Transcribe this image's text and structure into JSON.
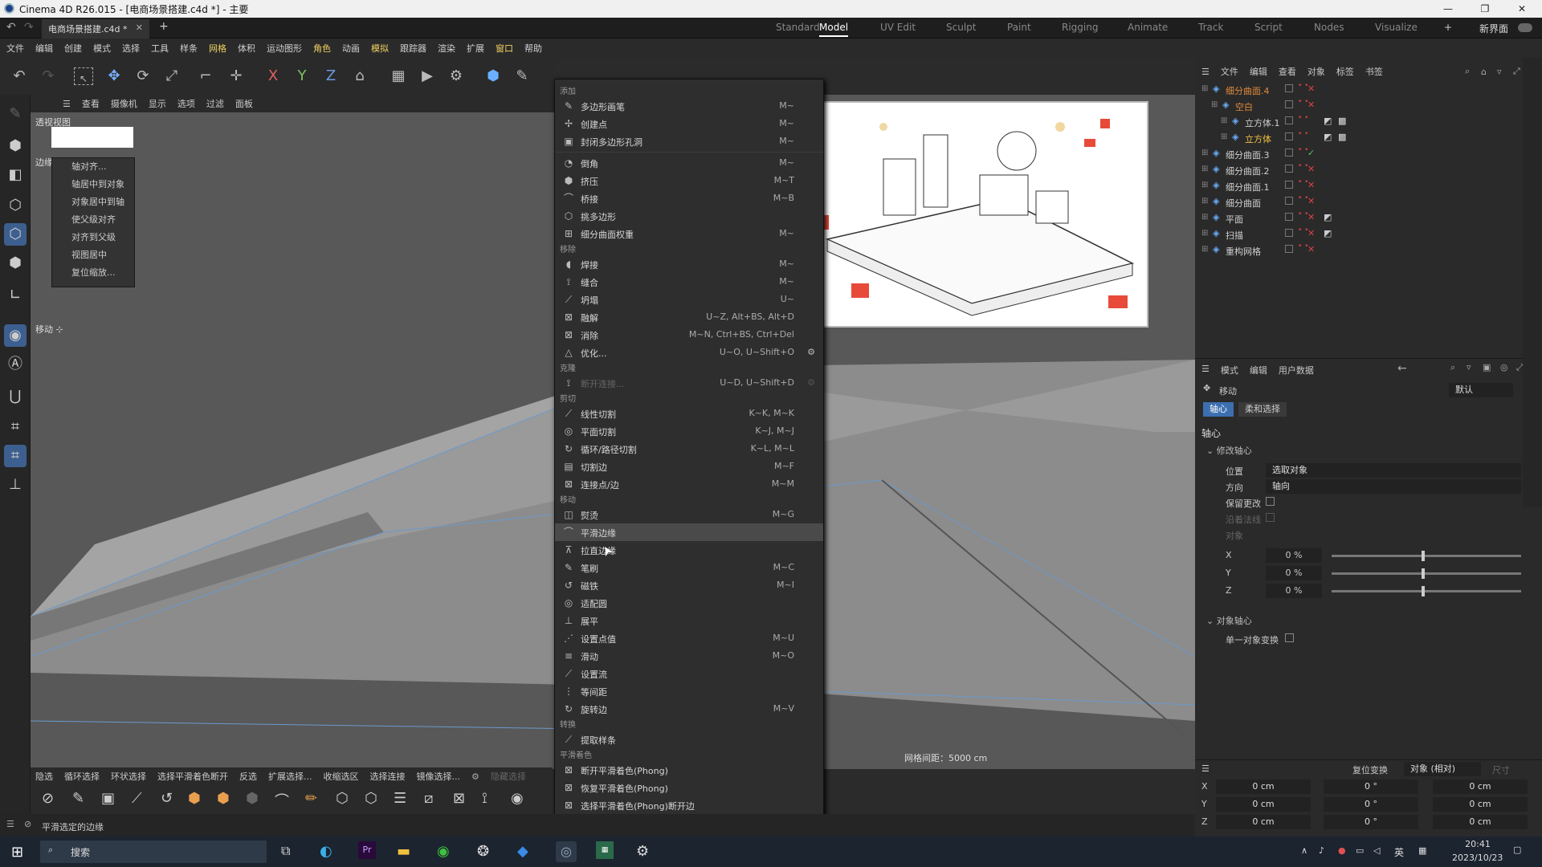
{
  "window": {
    "title": "Cinema 4D R26.015 - [电商场景搭建.c4d *] - 主要"
  },
  "doc_tab": "电商场景搭建.c4d *",
  "layouts": [
    "Standard",
    "Model",
    "UV Edit",
    "Sculpt",
    "Paint",
    "Rigging",
    "Animate",
    "Track",
    "Script",
    "Nodes",
    "Visualize"
  ],
  "new_layout": "新界面",
  "menubar": [
    "文件",
    "编辑",
    "创建",
    "模式",
    "选择",
    "工具",
    "样条",
    "网格",
    "体积",
    "运动图形",
    "角色",
    "动画",
    "模拟",
    "跟踪器",
    "渲染",
    "扩展",
    "窗口",
    "帮助"
  ],
  "viewport": {
    "menu": [
      "查看",
      "摄像机",
      "显示",
      "选项",
      "过滤",
      "面板"
    ],
    "label": "透视视图",
    "edge_label": "边缘",
    "move_label": "移动 ⊹",
    "grid_spacing": "网格间距：5000 cm"
  },
  "snap_menu": [
    "轴对齐...",
    "轴居中到对象",
    "对象居中到轴",
    "使父级对齐",
    "对齐到父级",
    "视图居中",
    "复位缩放..."
  ],
  "context_menu": {
    "sections": {
      "add": "添加",
      "remove": "移除",
      "clone": "克隆",
      "cut": "剪切",
      "move": "移动",
      "convert": "转换",
      "smooth": "平滑着色"
    },
    "add": [
      {
        "label": "多边形画笔",
        "sc": "M~"
      },
      {
        "label": "创建点",
        "sc": "M~"
      },
      {
        "label": "封闭多边形孔洞",
        "sc": "M~"
      }
    ],
    "add2": [
      {
        "label": "倒角",
        "sc": "M~"
      },
      {
        "label": "挤压",
        "sc": "M~T"
      },
      {
        "label": "桥接",
        "sc": "M~B"
      },
      {
        "label": "挑多边形",
        "sc": ""
      },
      {
        "label": "细分曲面权重",
        "sc": "M~"
      }
    ],
    "remove": [
      {
        "label": "焊接",
        "sc": "M~"
      },
      {
        "label": "缝合",
        "sc": "M~"
      },
      {
        "label": "坍塌",
        "sc": "U~"
      },
      {
        "label": "融解",
        "sc": "U~Z, Alt+BS, Alt+D"
      },
      {
        "label": "消除",
        "sc": "M~N, Ctrl+BS, Ctrl+Del"
      },
      {
        "label": "优化...",
        "sc": "U~O, U~Shift+O"
      }
    ],
    "clone": [
      {
        "label": "断开连接...",
        "sc": "U~D, U~Shift+D"
      }
    ],
    "cut": [
      {
        "label": "线性切割",
        "sc": "K~K, M~K"
      },
      {
        "label": "平面切割",
        "sc": "K~J, M~J"
      },
      {
        "label": "循环/路径切割",
        "sc": "K~L, M~L"
      },
      {
        "label": "切割边",
        "sc": "M~F"
      },
      {
        "label": "连接点/边",
        "sc": "M~M"
      }
    ],
    "move": [
      {
        "label": "熨烫",
        "sc": "M~G"
      },
      {
        "label": "平滑边缘",
        "sc": ""
      },
      {
        "label": "拉直边缘",
        "sc": ""
      },
      {
        "label": "笔刷",
        "sc": "M~C"
      },
      {
        "label": "磁铁",
        "sc": "M~I"
      },
      {
        "label": "适配圆",
        "sc": ""
      },
      {
        "label": "展平",
        "sc": ""
      },
      {
        "label": "设置点值",
        "sc": "M~U"
      },
      {
        "label": "滑动",
        "sc": "M~O"
      },
      {
        "label": "设置流",
        "sc": ""
      },
      {
        "label": "等间距",
        "sc": ""
      },
      {
        "label": "旋转边",
        "sc": "M~V"
      }
    ],
    "convert": [
      {
        "label": "提取样条",
        "sc": ""
      }
    ],
    "smooth": [
      {
        "label": "断开平滑着色(Phong)",
        "sc": ""
      },
      {
        "label": "恢复平滑着色(Phong)",
        "sc": ""
      },
      {
        "label": "选择平滑着色(Phong)断开边",
        "sc": ""
      }
    ]
  },
  "bottom_bar": [
    "隐选",
    "循环选择",
    "环状选择",
    "选择平滑着色断开",
    "反选",
    "扩展选择...",
    "收缩选区",
    "选择连接",
    "镜像选择...",
    "隐藏选择"
  ],
  "status_text": "平滑选定的边缘",
  "objects": {
    "menu": [
      "文件",
      "编辑",
      "查看",
      "对象",
      "标签",
      "书签"
    ],
    "items": [
      {
        "name": "细分曲面.4",
        "indent": 0,
        "color": "#e08a3c"
      },
      {
        "name": "空白",
        "indent": 1,
        "color": "#e08a3c"
      },
      {
        "name": "立方体.1",
        "indent": 2,
        "color": "#d0d0d0"
      },
      {
        "name": "立方体",
        "indent": 2,
        "color": "#f0c040"
      },
      {
        "name": "细分曲面.3",
        "indent": 0,
        "color": "#d0d0d0"
      },
      {
        "name": "细分曲面.2",
        "indent": 0,
        "color": "#d0d0d0"
      },
      {
        "name": "细分曲面.1",
        "indent": 0,
        "color": "#d0d0d0"
      },
      {
        "name": "细分曲面",
        "indent": 0,
        "color": "#d0d0d0"
      },
      {
        "name": "平面",
        "indent": 0,
        "color": "#d0d0d0"
      },
      {
        "name": "扫描",
        "indent": 0,
        "color": "#d0d0d0"
      },
      {
        "name": "重构网格",
        "indent": 0,
        "color": "#d0d0d0"
      }
    ]
  },
  "attributes": {
    "menu": [
      "模式",
      "编辑",
      "用户数据"
    ],
    "tool": "移动",
    "preset": "默认",
    "tabs": [
      "轴心",
      "柔和选择"
    ],
    "section": "轴心",
    "group1": "修改轴心",
    "fields": [
      {
        "label": "位置",
        "value": "选取对象"
      },
      {
        "label": "方向",
        "value": "轴向"
      }
    ],
    "keep": "保留更改",
    "align_normal": "沿着法线",
    "object": "对象",
    "xyz": [
      {
        "axis": "X",
        "value": "0 %"
      },
      {
        "axis": "Y",
        "value": "0 %"
      },
      {
        "axis": "Z",
        "value": "0 %"
      }
    ],
    "group2": "对象轴心",
    "single": "单一对象变换"
  },
  "coords": {
    "reset": "复位变换",
    "mode": "对象 (相对)",
    "size": "尺寸",
    "rows": [
      {
        "axis": "X",
        "pos": "0 cm",
        "rot": "0 °",
        "scale": "0 cm"
      },
      {
        "axis": "Y",
        "pos": "0 cm",
        "rot": "0 °",
        "scale": "0 cm"
      },
      {
        "axis": "Z",
        "pos": "0 cm",
        "rot": "0 °",
        "scale": "0 cm"
      }
    ]
  },
  "taskbar": {
    "search": "搜索",
    "lang": "英",
    "time": "20:41",
    "date": "2023/10/23"
  }
}
